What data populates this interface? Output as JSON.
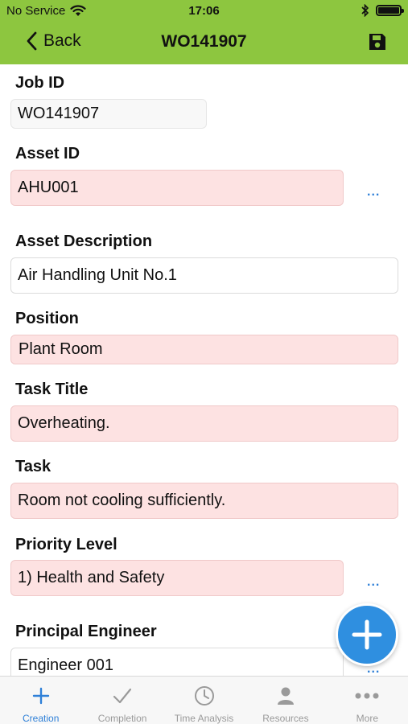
{
  "status_bar": {
    "carrier": "No Service",
    "time": "17:06"
  },
  "nav": {
    "back_label": "Back",
    "title": "WO141907"
  },
  "form": {
    "job_id": {
      "label": "Job ID",
      "value": "WO141907"
    },
    "asset_id": {
      "label": "Asset ID",
      "value": "AHU001",
      "more": "..."
    },
    "asset_description": {
      "label": "Asset Description",
      "value": "Air Handling Unit No.1"
    },
    "position": {
      "label": "Position",
      "value": "Plant Room"
    },
    "task_title": {
      "label": "Task Title",
      "value": "Overheating."
    },
    "task": {
      "label": "Task",
      "value": "Room not cooling sufficiently."
    },
    "priority_level": {
      "label": "Priority Level",
      "value": "1) Health and Safety",
      "more": "..."
    },
    "principal_engineer": {
      "label": "Principal Engineer",
      "value": "Engineer 001",
      "more": "..."
    }
  },
  "tabs": [
    {
      "label": "Creation",
      "icon": "plus-icon",
      "active": true
    },
    {
      "label": "Completion",
      "icon": "check-icon"
    },
    {
      "label": "Time Analysis",
      "icon": "clock-icon"
    },
    {
      "label": "Resources",
      "icon": "person-icon"
    },
    {
      "label": "More",
      "icon": "more-dots-icon"
    }
  ],
  "colors": {
    "header": "#8dc63f",
    "accent": "#2f80d8",
    "required_field": "#fde2e2"
  }
}
